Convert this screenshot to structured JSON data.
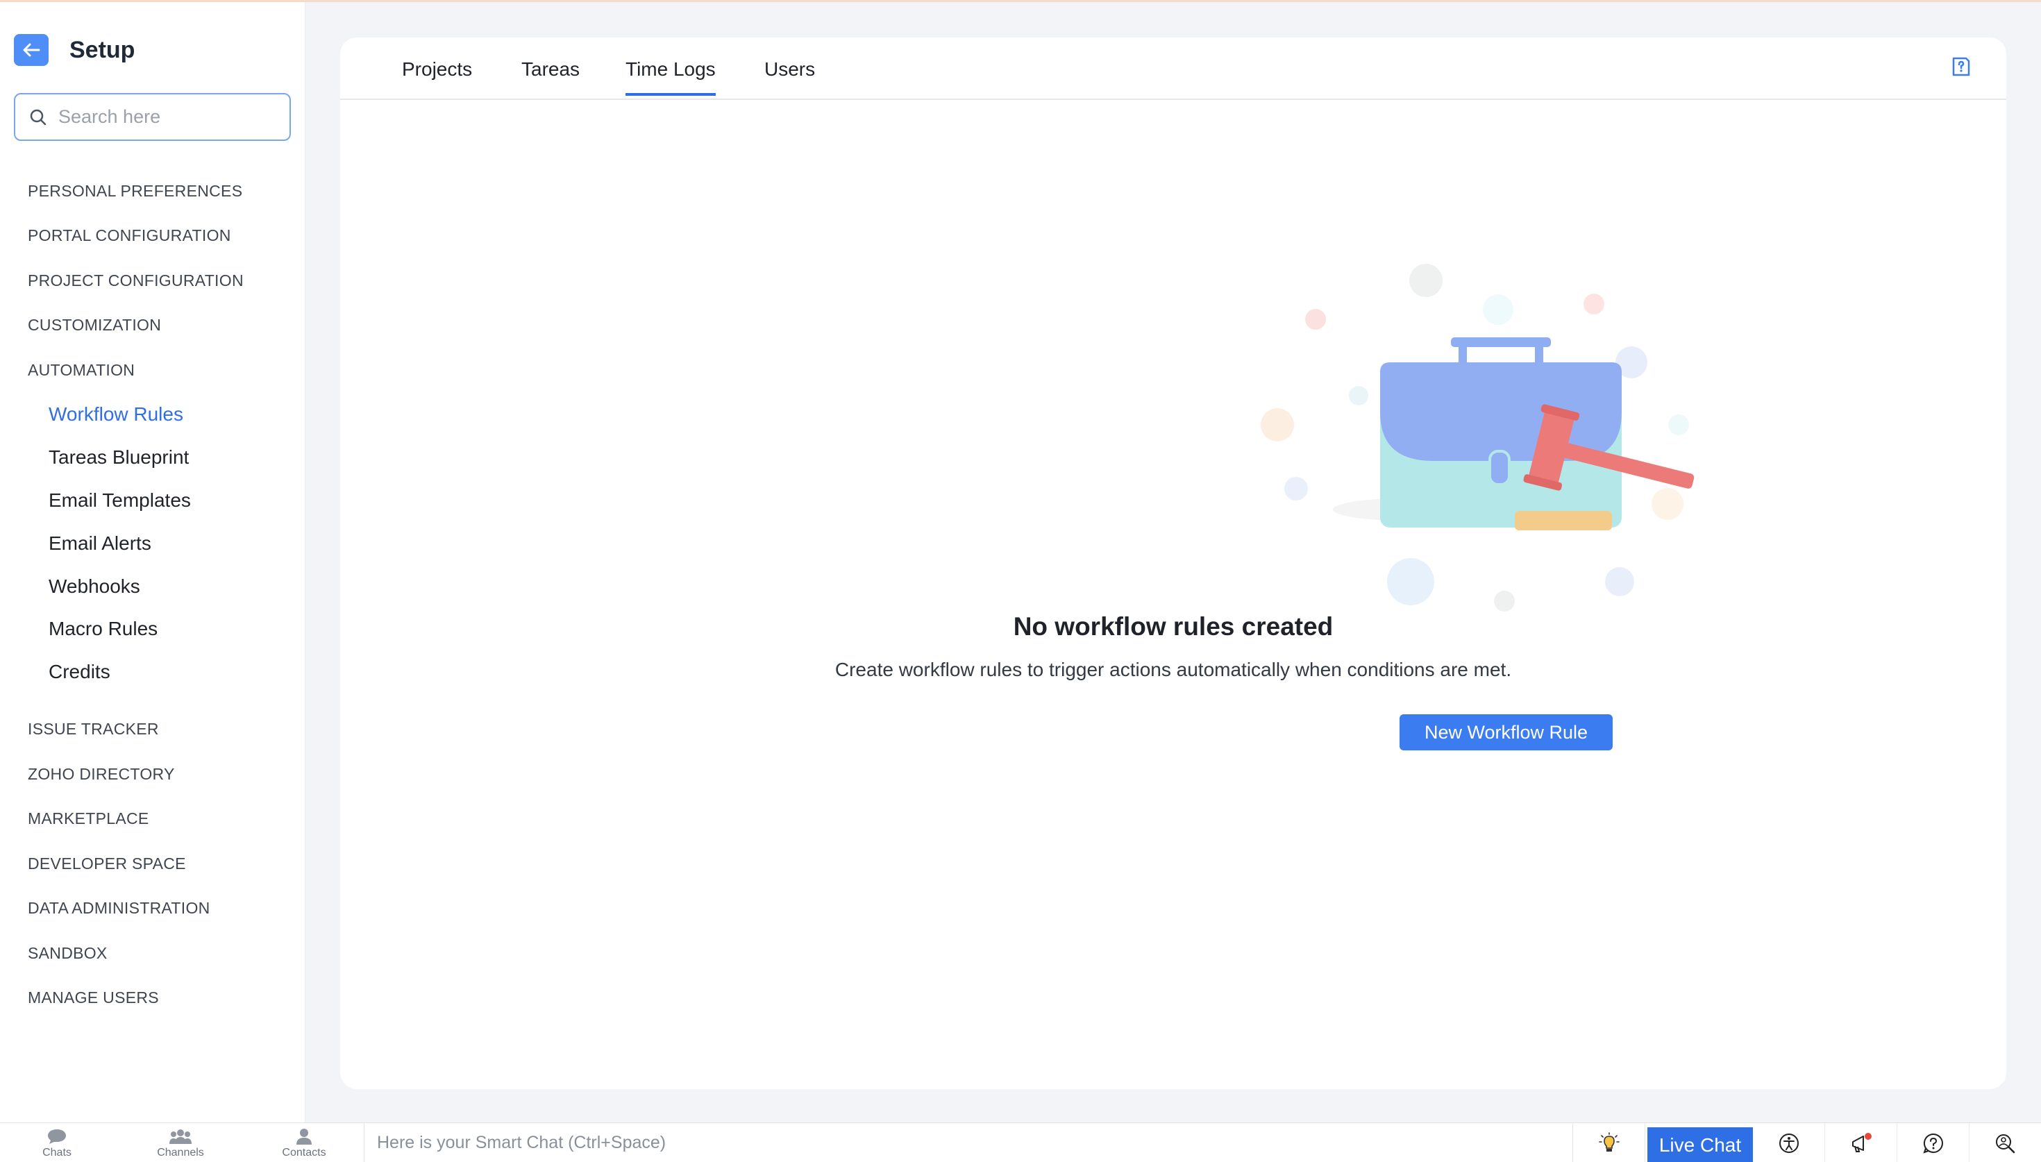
{
  "sidebar": {
    "title": "Setup",
    "search_placeholder": "Search here",
    "sections": [
      "PERSONAL PREFERENCES",
      "PORTAL CONFIGURATION",
      "PROJECT CONFIGURATION",
      "CUSTOMIZATION",
      "AUTOMATION",
      "ISSUE TRACKER",
      "ZOHO DIRECTORY",
      "MARKETPLACE",
      "DEVELOPER SPACE",
      "DATA ADMINISTRATION",
      "SANDBOX",
      "MANAGE USERS"
    ],
    "automation_items": [
      "Workflow Rules",
      "Tareas Blueprint",
      "Email Templates",
      "Email Alerts",
      "Webhooks",
      "Macro Rules",
      "Credits"
    ],
    "active_item": "Workflow Rules"
  },
  "tabs": [
    "Projects",
    "Tareas",
    "Time Logs",
    "Users"
  ],
  "active_tab": "Time Logs",
  "empty_state": {
    "title": "No workflow rules created",
    "description": "Create workflow rules to trigger actions automatically when conditions are met.",
    "button": "New Workflow Rule"
  },
  "bottombar": {
    "items": [
      "Chats",
      "Channels",
      "Contacts"
    ],
    "smart_chat_placeholder": "Here is your Smart Chat (Ctrl+Space)",
    "live_chat": "Live Chat",
    "icons": [
      "bulb-icon",
      "accessibility-icon",
      "announcement-icon",
      "help-icon",
      "search-people-icon"
    ]
  },
  "colors": {
    "accent": "#2f6fe6",
    "button": "#3b7cf0",
    "background": "#f3f4f7"
  }
}
